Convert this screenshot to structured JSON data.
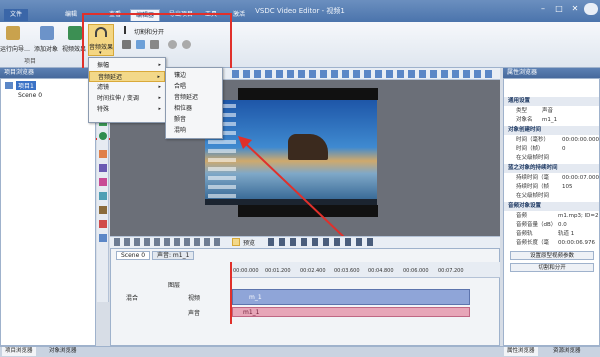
{
  "app": {
    "title": "VSDC Video Editor - 视频1"
  },
  "tabs": [
    "文件",
    "编辑",
    "查看",
    "编辑器",
    "导出项目",
    "工具",
    "激活"
  ],
  "ribbon": {
    "buttons": [
      "运行向导…",
      "添加对象",
      "视频效果",
      "音频效果"
    ],
    "cut_split": "切割和分开",
    "group_labels": [
      "项目",
      "剪辑"
    ]
  },
  "audio_menu": {
    "items": [
      "振幅",
      "音频延迟",
      "滤镜",
      "时间拉伸 / 变调",
      "特殊"
    ],
    "submenu": [
      "镶边",
      "合唱",
      "音频延迟",
      "相位器",
      "颤音",
      "混响"
    ]
  },
  "left_panel": {
    "title": "项目浏览器",
    "project": "项目1",
    "scene": "Scene 0"
  },
  "props": {
    "title": "属性浏览器",
    "sections": {
      "general": "通用设置",
      "obj_create_time": "对象创建时间",
      "obj_duration": "蓝之对象的持续时间",
      "audio_settings": "音频对象设置"
    },
    "rows": [
      {
        "k": "类型",
        "v": "声音"
      },
      {
        "k": "对象名",
        "v": "m1_1"
      },
      {
        "k": "时间（毫秒）",
        "v": "00:00:00.000"
      },
      {
        "k": "时间（帧）",
        "v": "0"
      },
      {
        "k": "在父级帧时间",
        "v": ""
      },
      {
        "k": "持续时间（毫",
        "v": "00:00:07.000"
      },
      {
        "k": "持续时间（帧",
        "v": "105"
      },
      {
        "k": "在父级帧时间",
        "v": ""
      },
      {
        "k": "音频",
        "v": "m1.mp3; ID=2"
      },
      {
        "k": "音频音量（dB）",
        "v": "0.0"
      },
      {
        "k": "音频轨",
        "v": "轨道 1"
      },
      {
        "k": "音频长度（毫",
        "v": "00:00:06.976"
      }
    ],
    "buttons": [
      "设置原型视频参数",
      "切割和分开"
    ]
  },
  "timeline": {
    "tabs": [
      "Scene 0",
      "声音: m1_1"
    ],
    "ticks": [
      "00:00.000",
      "00:01.200",
      "00:02.400",
      "00:03.600",
      "00:04.800",
      "00:06.000",
      "00:07.200"
    ],
    "tracks": [
      "混合",
      "视频",
      "声音"
    ],
    "layer": "图层",
    "clip_video": "m_1",
    "clip_audio": "m1_1",
    "preview": "预览"
  },
  "status": {
    "left_tab": "项目浏览器",
    "left_tab2": "对象浏览器",
    "right_tab": "属性浏览器",
    "right_tab2": "资源浏览器"
  },
  "colors": {
    "accent": "#4b74ac",
    "highlight": "#f3d889",
    "annotation": "#e0302b",
    "video_clip": "#8fa5d8",
    "audio_clip": "#e7a6b8"
  }
}
